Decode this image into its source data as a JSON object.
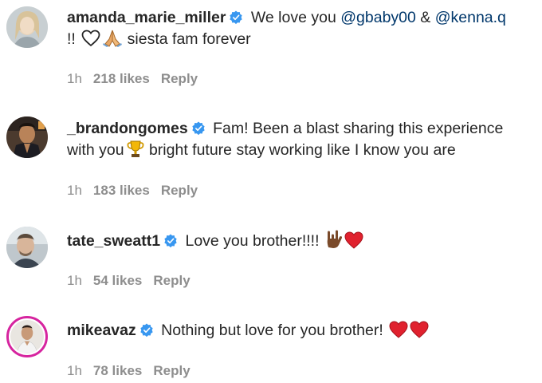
{
  "comments": [
    {
      "username": "amanda_marie_miller",
      "text_parts": {
        "lead": " We love you ",
        "mention1": "@gbaby00",
        "mid": " & ",
        "mention2": "@kenna.q",
        "line2_start": "!! ",
        "line2_end": " siesta fam forever"
      },
      "time": "1h",
      "likes": "218 likes",
      "reply": "Reply",
      "emojis": [
        "white-heart-icon",
        "praying-hands-icon"
      ]
    },
    {
      "username": "_brandongomes",
      "text_parts": {
        "lead": " Fam! Been a blast sharing this experience",
        "line2_start": "with you",
        "line2_end": " bright future stay working like I know you are"
      },
      "time": "1h",
      "likes": "183 likes",
      "reply": "Reply",
      "emojis": [
        "trophy-icon"
      ]
    },
    {
      "username": "tate_sweatt1",
      "text_parts": {
        "lead": " Love you brother!!!! "
      },
      "time": "1h",
      "likes": "54 likes",
      "reply": "Reply",
      "emojis": [
        "love-you-gesture-icon",
        "red-heart-icon"
      ]
    },
    {
      "username": "mikeavaz",
      "text_parts": {
        "lead": " Nothing but love for you brother! "
      },
      "time": "1h",
      "likes": "78 likes",
      "reply": "Reply",
      "emojis": [
        "red-heart-icon",
        "red-heart-icon"
      ]
    }
  ],
  "colors": {
    "text": "#262626",
    "meta": "#8e8e8e",
    "mention": "#00376b",
    "verified": "#3897f0",
    "heart_red": "#e0212e"
  }
}
